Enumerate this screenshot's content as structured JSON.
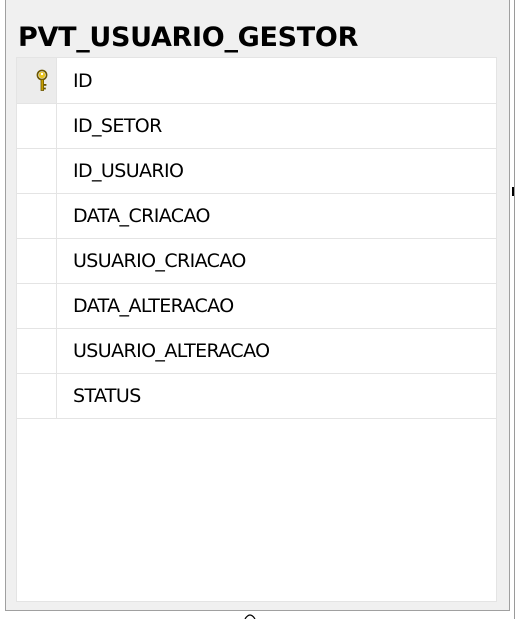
{
  "table": {
    "name": "PVT_USUARIO_GESTOR",
    "columns": [
      {
        "name": "ID",
        "primary_key": true,
        "icon": "key-icon"
      },
      {
        "name": "ID_SETOR",
        "primary_key": false
      },
      {
        "name": "ID_USUARIO",
        "primary_key": false
      },
      {
        "name": "DATA_CRIACAO",
        "primary_key": false
      },
      {
        "name": "USUARIO_CRIACAO",
        "primary_key": false
      },
      {
        "name": "DATA_ALTERACAO",
        "primary_key": false
      },
      {
        "name": "USUARIO_ALTERACAO",
        "primary_key": false
      },
      {
        "name": "STATUS",
        "primary_key": false
      }
    ]
  },
  "colors": {
    "frame_background": "#f0f0f0",
    "grid_background": "#ffffff",
    "grid_line": "#e4e4e4",
    "frame_border": "#a0a0a0",
    "key_gold": "#d9b000"
  }
}
